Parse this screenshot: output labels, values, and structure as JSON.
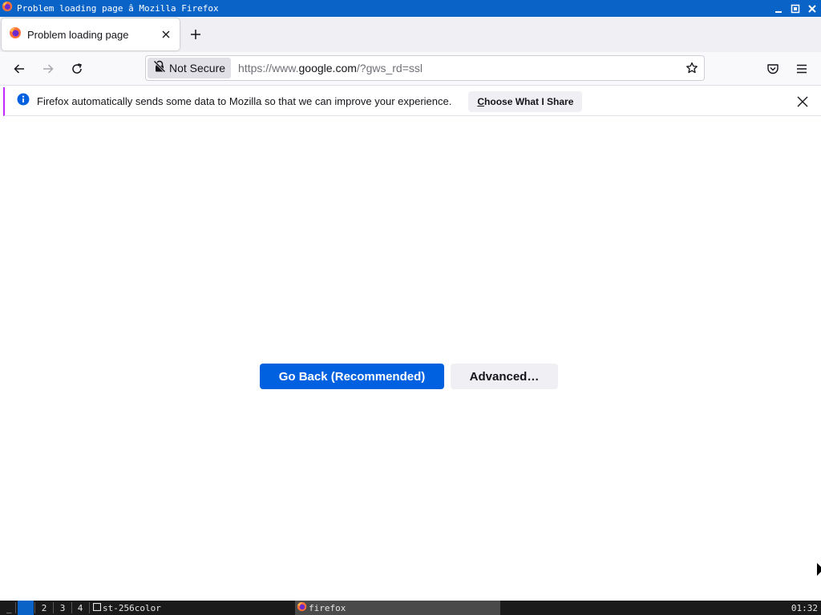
{
  "window": {
    "title": "Problem loading page â Mozilla Firefox"
  },
  "tabs": [
    {
      "label": "Problem loading page",
      "icon": "firefox-icon",
      "active": true
    }
  ],
  "navbar": {
    "security_label": "Not Secure",
    "url_prefix": "https://www.",
    "url_host": "google.com",
    "url_suffix": "/?gws_rd=ssl"
  },
  "notification": {
    "message": "Firefox automatically sends some data to Mozilla so that we can improve your experience.",
    "button_accesskey": "C",
    "button_label_rest": "hoose What I Share",
    "accent_color": "#c02aff"
  },
  "page": {
    "go_back_label": "Go Back (Recommended)",
    "advanced_label": "Advanced…",
    "primary_color": "#0061e0"
  },
  "taskbar": {
    "launcher": "_",
    "workspaces": [
      "",
      "2",
      "3",
      "4"
    ],
    "active_workspace": 1,
    "terminal_task": "st-256color",
    "firefox_task": "firefox",
    "clock": "01:32",
    "accent_color": "#0a64c8"
  }
}
